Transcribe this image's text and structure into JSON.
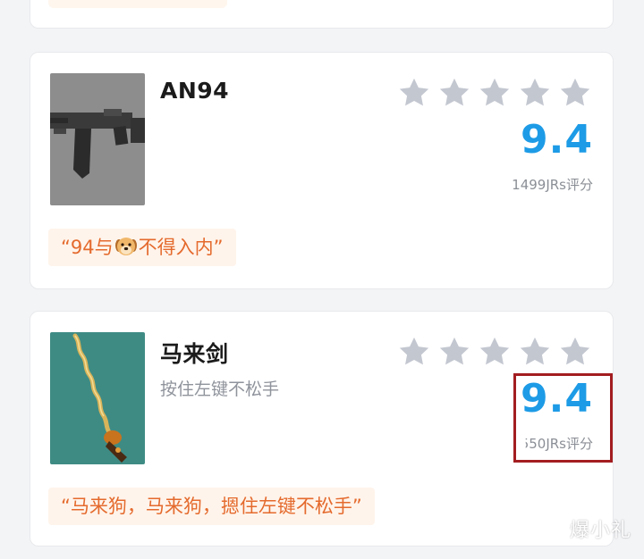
{
  "items": [
    {
      "name": "AN94",
      "subtitle": "",
      "stars": 5,
      "score": "9.4",
      "rating_count": "1499JRs评分",
      "quote_open": "“94与",
      "quote_emoji": "dog-face",
      "quote_close": "不得入内”",
      "image": "an94-rifle-image"
    },
    {
      "name": "马来剑",
      "subtitle": "按住左键不松手",
      "stars": 5,
      "score": "9.4",
      "rating_count": "550JRs评分",
      "quote": "“马来狗，马来狗，摁住左键不松手”",
      "image": "kris-sword-image"
    }
  ],
  "watermark": "爆小礼",
  "colors": {
    "score": "#1d9be6",
    "star": "#c3c7d0",
    "quote_text": "#e46a2d",
    "quote_bg": "#fff4eb",
    "highlight": "#a31d20"
  }
}
